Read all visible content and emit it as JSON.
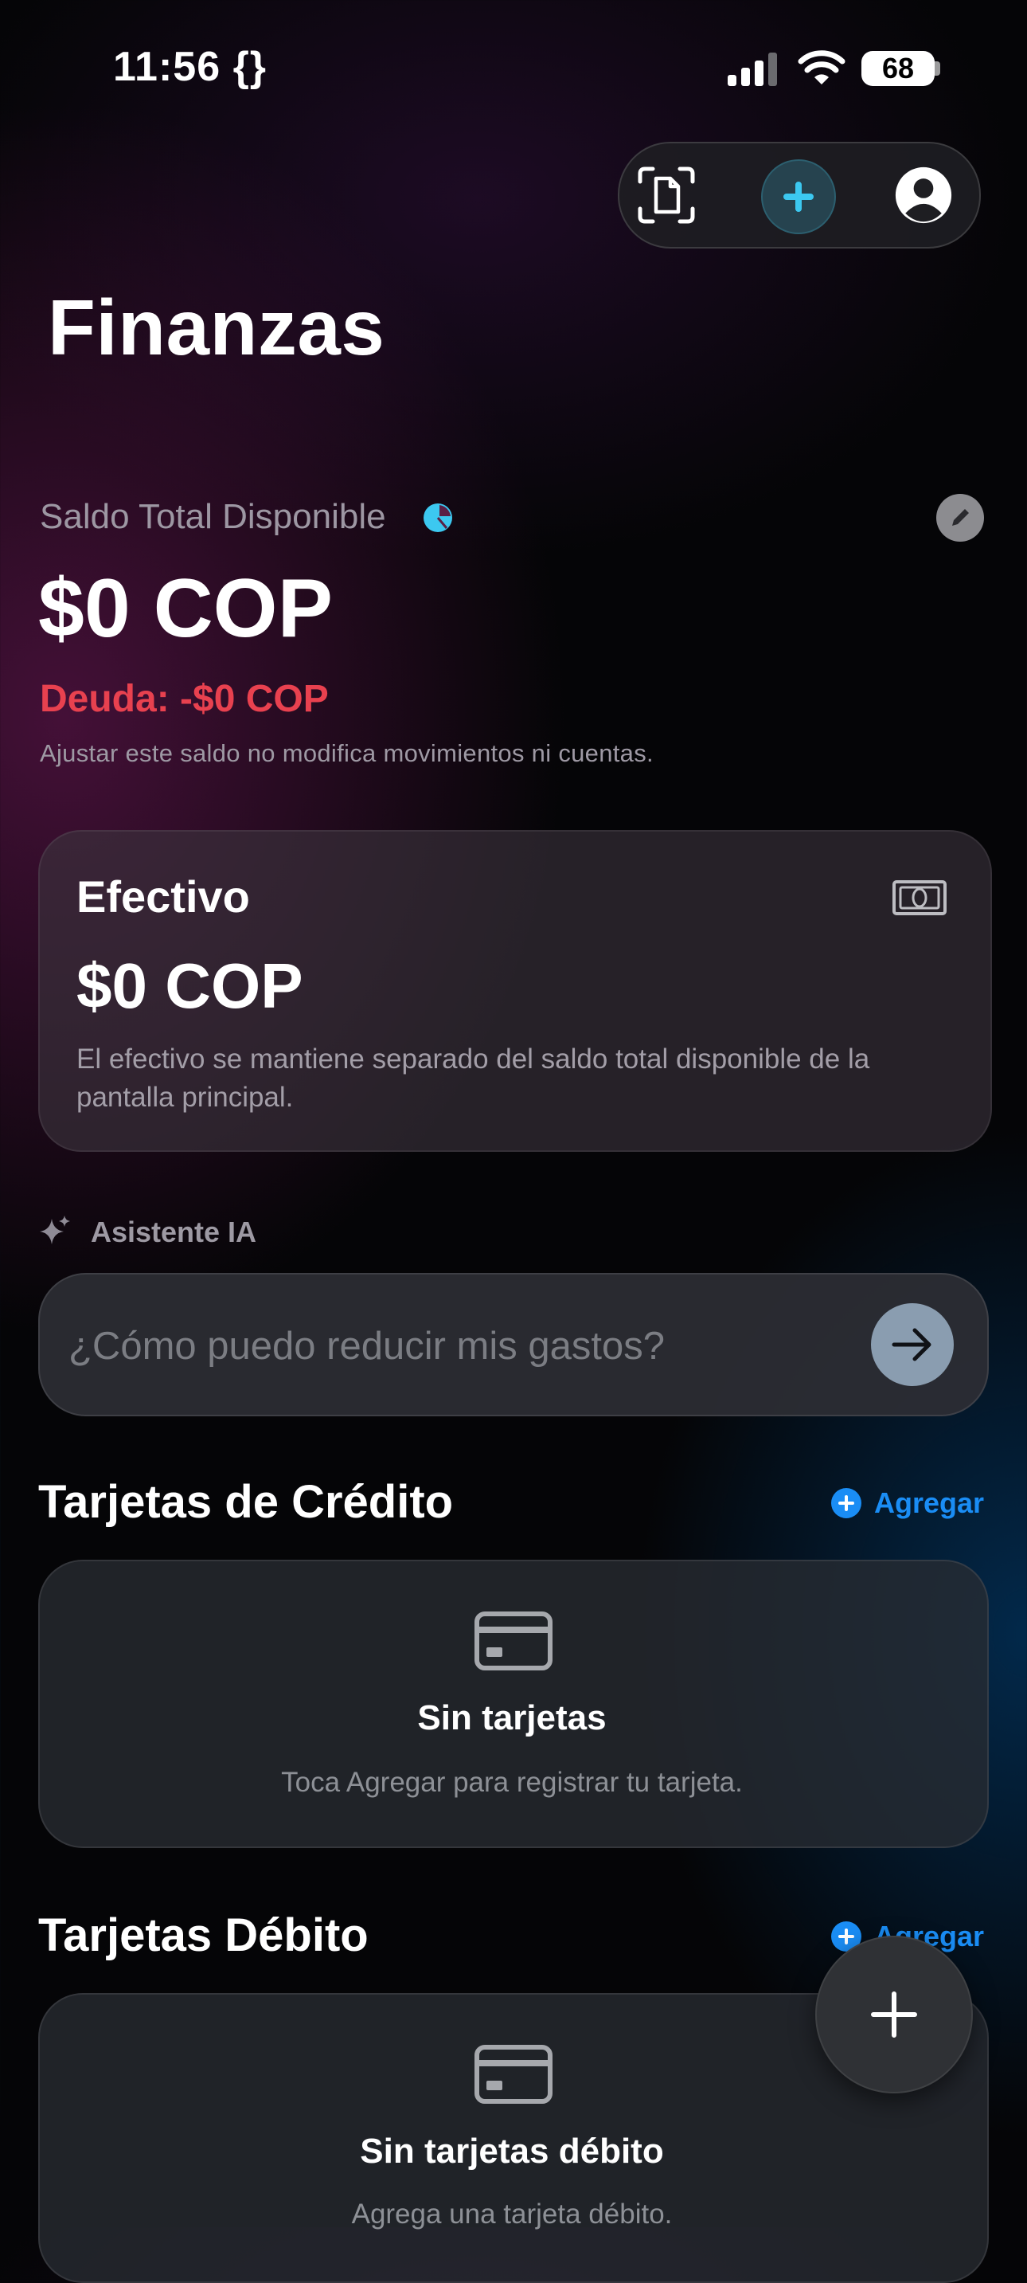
{
  "status_bar": {
    "time": "11:56 {}",
    "battery": "68"
  },
  "header": {
    "title": "Finanzas",
    "icons": [
      "document-scan-icon",
      "plus-icon",
      "person-icon"
    ]
  },
  "balance": {
    "label": "Saldo Total Disponible",
    "amount": "$0 COP",
    "debt": "Deuda: -$0 COP",
    "note": "Ajustar este saldo no modifica movimientos ni cuentas."
  },
  "cash": {
    "title": "Efectivo",
    "amount": "$0 COP",
    "description": "El efectivo se mantiene separado del saldo total disponible de la pantalla principal."
  },
  "assistant": {
    "label": "Asistente IA",
    "placeholder": "¿Cómo puedo reducir mis gastos?"
  },
  "credit_cards": {
    "title": "Tarjetas de Crédito",
    "add_label": "Agregar",
    "empty_title": "Sin tarjetas",
    "empty_subtitle": "Toca Agregar para registrar tu tarjeta."
  },
  "debit_cards": {
    "title": "Tarjetas Débito",
    "add_label": "Agregar",
    "empty_title": "Sin tarjetas débito",
    "empty_subtitle": "Agrega una tarjeta débito."
  },
  "colors": {
    "accent": "#1a8df5",
    "debt": "#e8414f",
    "cyan": "#3cc8f0"
  }
}
